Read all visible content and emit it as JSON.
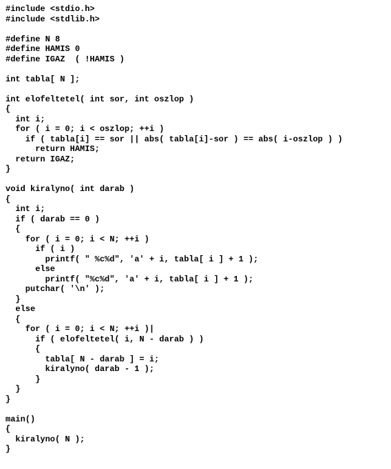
{
  "code": {
    "lines": [
      "#include <stdio.h>",
      "#include <stdlib.h>",
      "",
      "#define N 8",
      "#define HAMIS 0",
      "#define IGAZ  ( !HAMIS )",
      "",
      "int tabla[ N ];",
      "",
      "int elofeltetel( int sor, int oszlop )",
      "{",
      "  int i;",
      "  for ( i = 0; i < oszlop; ++i )",
      "    if ( tabla[i] == sor || abs( tabla[i]-sor ) == abs( i-oszlop ) )",
      "      return HAMIS;",
      "  return IGAZ;",
      "}",
      "",
      "void kiralyno( int darab )",
      "{",
      "  int i;",
      "  if ( darab == 0 )",
      "  {",
      "    for ( i = 0; i < N; ++i )",
      "      if ( i )",
      "        printf( \" %c%d\", 'a' + i, tabla[ i ] + 1 );",
      "      else",
      "        printf( \"%c%d\", 'a' + i, tabla[ i ] + 1 );",
      "    putchar( '\\n' );",
      "  }",
      "  else",
      "  {",
      "    for ( i = 0; i < N; ++i )|",
      "      if ( elofeltetel( i, N - darab ) )",
      "      {",
      "        tabla[ N - darab ] = i;",
      "        kiralyno( darab - 1 );",
      "      }",
      "  }",
      "}",
      "",
      "main()",
      "{",
      "  kiralyno( N );",
      "}"
    ]
  },
  "cursor": {
    "line_index": 32,
    "after_text": "    for ( i = 0; i < N; ++i )"
  }
}
